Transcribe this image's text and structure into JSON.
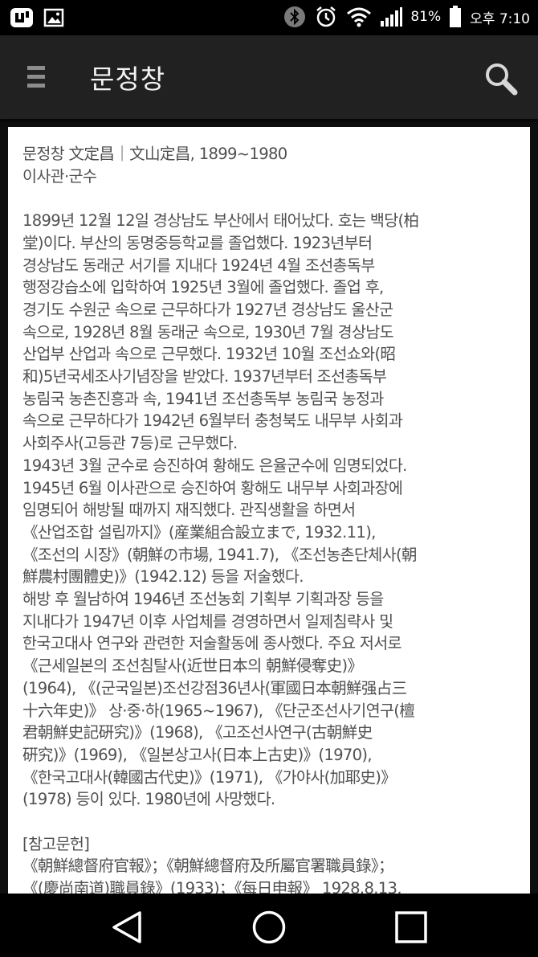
{
  "status_bar": {
    "battery": "81%",
    "time": "오후 7:10"
  },
  "app_bar": {
    "title": "문정창",
    "menu_icon": "hamburger-menu-icon",
    "search_icon": "search-icon"
  },
  "article": {
    "header_lines": [
      "문정창 文定昌｜文山定昌, 1899~1980",
      "이사관·군수"
    ],
    "body_lines": [
      "1899년 12월 12일 경상남도 부산에서 태어났다. 호는 백당(柏",
      "堂)이다. 부산의 동명중등학교를 졸업했다. 1923년부터",
      "경상남도 동래군 서기를 지내다 1924년 4월 조선총독부",
      "행정강습소에 입학하여 1925년 3월에 졸업했다. 졸업 후,",
      "경기도 수원군 속으로 근무하다가 1927년 경상남도 울산군",
      "속으로, 1928년 8월 동래군 속으로, 1930년 7월 경상남도",
      "산업부 산업과 속으로 근무했다. 1932년 10월 조선쇼와(昭",
      "和)5년국세조사기념장을 받았다. 1937년부터 조선총독부",
      "농림국 농촌진흥과 속, 1941년 조선총독부 농림국 농정과",
      "속으로 근무하다가 1942년 6월부터 충청북도 내무부 사회과",
      "사회주사(고등관 7등)로 근무했다.",
      "1943년 3월 군수로 승진하여 황해도 은율군수에 임명되었다.",
      "1945년 6월 이사관으로 승진하여 황해도 내무부 사회과장에",
      "임명되어 해방될 때까지 재직했다. 관직생활을 하면서",
      "《산업조합 설립까지》(産業組合設立まで, 1932.11),",
      "《조선의 시장》(朝鮮の市場, 1941.7), 《조선농촌단체사(朝",
      "鮮農村團體史)》(1942.12) 등을 저술했다.",
      "해방 후 월남하여 1946년 조선농회 기획부 기획과장 등을",
      "지내다가 1947년 이후 사업체를 경영하면서 일제침략사 및",
      "한국고대사 연구와 관련한 저술활동에 종사했다. 주요 저서로",
      "《근세일본의 조선침탈사(近世日本의 朝鮮侵奪史)》",
      "(1964), 《(군국일본)조선강점36년사(軍國日本朝鮮强占三",
      "十六年史)》 상·중·하(1965~1967), 《단군조선사기연구(檀",
      "君朝鮮史記硏究)》(1968), 《고조선사연구(古朝鮮史",
      "硏究)》(1969), 《일본상고사(日本上古史)》(1970),",
      "《한국고대사(韓國古代史)》(1971), 《가야사(加耶史)》",
      "(1978) 등이 있다. 1980년에 사망했다."
    ],
    "references_title": "[참고문헌]",
    "references_lines": [
      "《朝鮮總督府官報》；《朝鮮總督府及所屬官署職員錄》；",
      "《(慶尚南道)職員錄》(1933)；《每日申報》 1928.8.13,"
    ]
  },
  "nav_bar": {
    "back_icon": "back-triangle-icon",
    "home_icon": "home-circle-icon",
    "recents_icon": "recents-square-icon"
  }
}
